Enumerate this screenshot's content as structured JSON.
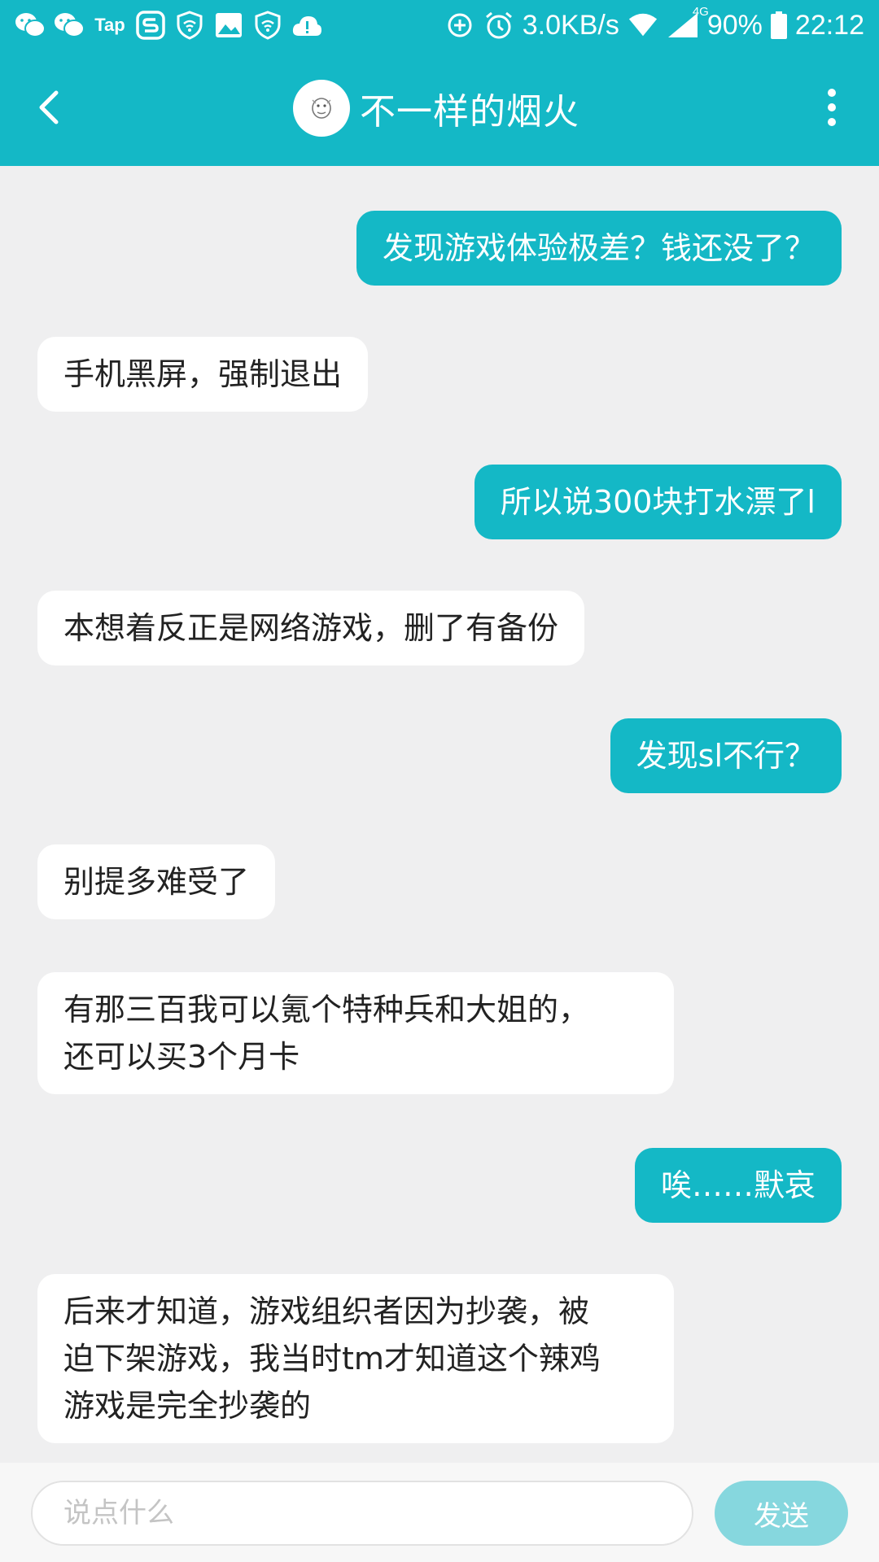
{
  "status_bar": {
    "left_icons": [
      "wechat-icon",
      "wechat-icon",
      "tap-icon",
      "s-app-icon",
      "shield-wifi-icon",
      "image-icon",
      "shield-wifi-icon",
      "cloud-alert-icon"
    ],
    "tap_label": "Tap",
    "speed": "3.0KB/s",
    "network": "4G",
    "battery": "90%",
    "time": "22:12"
  },
  "header": {
    "title": "不一样的烟火",
    "back_icon": "chevron-left-icon",
    "menu_icon": "more-vert-icon"
  },
  "messages": [
    {
      "side": "out",
      "text": "发现游戏体验极差？钱还没了？"
    },
    {
      "side": "in",
      "text": "手机黑屏，强制退出"
    },
    {
      "side": "out",
      "text": "所以说300块打水漂了l"
    },
    {
      "side": "in",
      "text": "本想着反正是网络游戏，删了有备份"
    },
    {
      "side": "out",
      "text": "发现sl不行？"
    },
    {
      "side": "in",
      "text": "别提多难受了"
    },
    {
      "side": "in",
      "text": "有那三百我可以氪个特种兵和大姐的，\n还可以买3个月卡"
    },
    {
      "side": "out",
      "text": "唉……默哀"
    },
    {
      "side": "in",
      "text": "后来才知道，游戏组织者因为抄袭，被\n迫下架游戏，我当时tm才知道这个辣鸡\n游戏是完全抄袭的"
    }
  ],
  "input": {
    "placeholder": "说点什么",
    "value": "",
    "send_label": "发送"
  },
  "colors": {
    "accent": "#14b8c6",
    "background": "#efeff0",
    "send_disabled": "#86d7de"
  }
}
